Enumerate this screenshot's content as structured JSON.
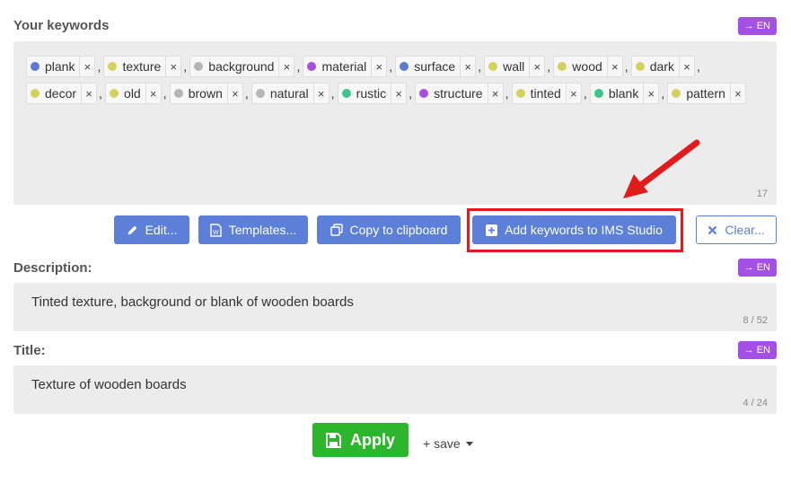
{
  "keywords_section": {
    "label": "Your keywords",
    "translate_badge": "→ EN",
    "counter": "17",
    "keywords": [
      {
        "text": "plank",
        "color": "#5b7ad6"
      },
      {
        "text": "texture",
        "color": "#d2d25c"
      },
      {
        "text": "background",
        "color": "#b5b5b5"
      },
      {
        "text": "material",
        "color": "#a650e0"
      },
      {
        "text": "surface",
        "color": "#5b7ad6"
      },
      {
        "text": "wall",
        "color": "#d2d25c"
      },
      {
        "text": "wood",
        "color": "#d2d25c"
      },
      {
        "text": "dark",
        "color": "#d2d25c"
      },
      {
        "text": "decor",
        "color": "#d2d25c"
      },
      {
        "text": "old",
        "color": "#d2d25c"
      },
      {
        "text": "brown",
        "color": "#b5b5b5"
      },
      {
        "text": "natural",
        "color": "#b5b5b5"
      },
      {
        "text": "rustic",
        "color": "#3ec48f"
      },
      {
        "text": "structure",
        "color": "#a650e0"
      },
      {
        "text": "tinted",
        "color": "#d2d25c"
      },
      {
        "text": "blank",
        "color": "#3ec48f"
      },
      {
        "text": "pattern",
        "color": "#d2d25c"
      }
    ]
  },
  "actions": {
    "edit": "Edit...",
    "templates": "Templates...",
    "copy": "Copy to clipboard",
    "add_ims": "Add keywords to IMS Studio",
    "clear": "Clear..."
  },
  "description_section": {
    "label": "Description:",
    "translate_badge": "→ EN",
    "value": "Tinted texture, background or blank of wooden boards",
    "counter": "8 / 52"
  },
  "title_section": {
    "label": "Title:",
    "translate_badge": "→ EN",
    "value": "Texture of wooden boards",
    "counter": "4 / 24"
  },
  "footer": {
    "apply": "Apply",
    "save": "+ save"
  },
  "colors": {
    "accent_blue": "#5c7fd9",
    "badge_purple": "#a450e6",
    "apply_green": "#2db52d",
    "highlight_red": "#e01b1b"
  }
}
